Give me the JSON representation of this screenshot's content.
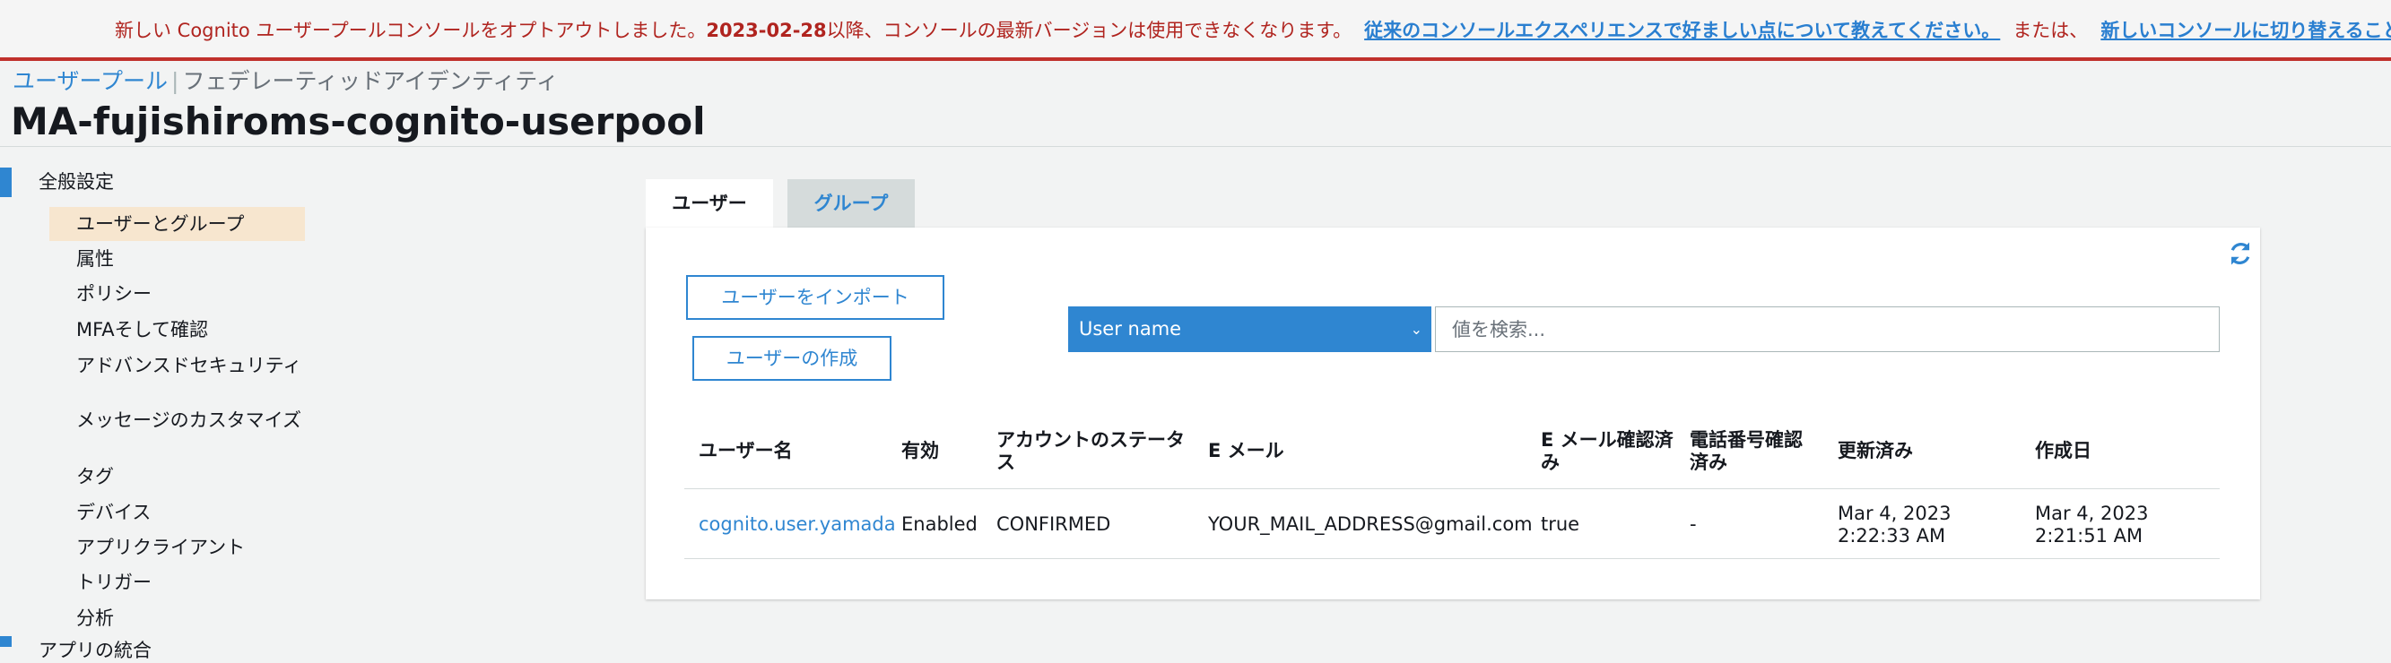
{
  "banner": {
    "text_1": "新しい Cognito ユーザープールコンソールをオプトアウトしました。",
    "date": "2023-02-28",
    "text_2": "以降、コンソールの最新バージョンは使用できなくなります。",
    "link_feedback": "従来のコンソールエクスペリエンスで好ましい点について教えてください。",
    "text_or": "または、",
    "link_switch": "新しいコンソールに切り替えることができ"
  },
  "breadcrumb": {
    "user_pools": "ユーザープール",
    "federated_identities": "フェデレーティッドアイデンティティ"
  },
  "page_title": "MA-fujishiroms-cognito-userpool",
  "sidebar": {
    "section_general": "全般設定",
    "items": [
      {
        "label": "ユーザーとグループ",
        "active": true
      },
      {
        "label": "属性"
      },
      {
        "label": "ポリシー"
      },
      {
        "label": "MFAそして確認"
      },
      {
        "label": "アドバンスドセキュリティ"
      },
      {
        "label": "メッセージのカスタマイズ"
      },
      {
        "label": "タグ"
      },
      {
        "label": "デバイス"
      },
      {
        "label": "アプリクライアント"
      },
      {
        "label": "トリガー"
      },
      {
        "label": "分析"
      }
    ],
    "section_app_integration": "アプリの統合"
  },
  "tabs": [
    {
      "label": "ユーザー",
      "active": true
    },
    {
      "label": "グループ"
    }
  ],
  "toolbar": {
    "import_users": "ユーザーをインポート",
    "create_user": "ユーザーの作成",
    "filter_attribute": "User name",
    "search_placeholder": "値を検索..."
  },
  "table": {
    "headers": {
      "username": "ユーザー名",
      "enabled": "有効",
      "account_status": "アカウントのステータス",
      "email": "E メール",
      "email_verified": "E メール確認済み",
      "phone_verified": "電話番号確認済み",
      "updated": "更新済み",
      "created": "作成日"
    },
    "rows": [
      {
        "username": "cognito.user.yamada",
        "enabled": "Enabled",
        "account_status": "CONFIRMED",
        "email": "YOUR_MAIL_ADDRESS@gmail.com",
        "email_verified": "true",
        "phone_verified": "-",
        "updated": "Mar 4, 2023 2:22:33 AM",
        "created": "Mar 4, 2023 2:21:51 AM"
      }
    ]
  },
  "colors": {
    "accent": "#2f86d1",
    "banner_text": "#b0241f",
    "active_item_bg": "#f7e6cf"
  },
  "icons": {
    "refresh": "refresh-icon",
    "dropdown": "chevron-down-icon"
  }
}
